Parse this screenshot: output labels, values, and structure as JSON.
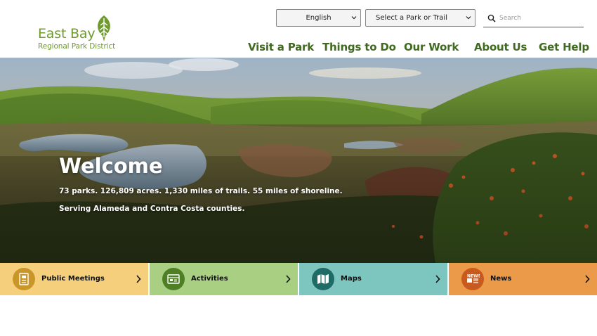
{
  "header": {
    "logo": {
      "line1": "East Bay",
      "line2": "Regional Park District"
    },
    "language_select": {
      "value": "English"
    },
    "park_select": {
      "value": "Select a Park or Trail"
    },
    "search": {
      "placeholder": "Search"
    },
    "nav": [
      "Visit a Park",
      "Things to Do",
      "Our Work",
      "About Us",
      "Get Help"
    ]
  },
  "hero": {
    "title": "Welcome",
    "line1": "73 parks. 126,809 acres. 1,330 miles of trails. 55 miles of shoreline.",
    "line2": "Serving Alameda and Contra Costa counties."
  },
  "tiles": [
    {
      "label": "Public Meetings",
      "icon": "document-icon",
      "color": "#f5cf7b",
      "icon_color": "#c9962a"
    },
    {
      "label": "Activities",
      "icon": "calendar-icon",
      "color": "#a8cf82",
      "icon_color": "#4f7f25"
    },
    {
      "label": "Maps",
      "icon": "map-icon",
      "color": "#7dc6bf",
      "icon_color": "#1f6b66"
    },
    {
      "label": "News",
      "icon": "news-icon",
      "color": "#ea9a48",
      "icon_color": "#c85a1e"
    }
  ],
  "colors": {
    "brand_green": "#6f9a2e",
    "nav_green": "#3f6a1f"
  }
}
